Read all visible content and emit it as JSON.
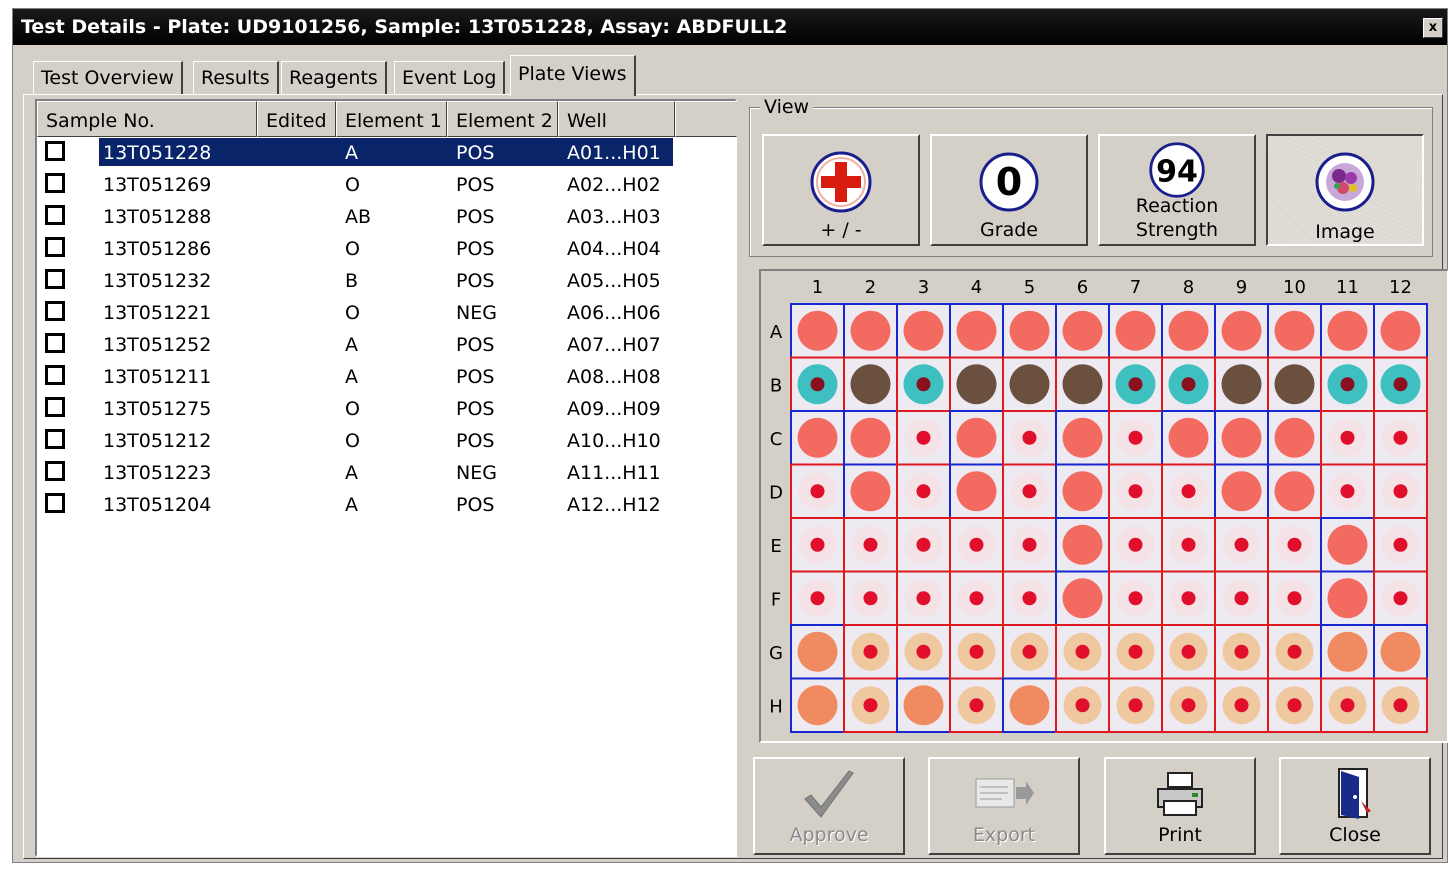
{
  "window": {
    "title": "Test Details - Plate: UD9101256, Sample: 13T051228, Assay: ABDFULL2",
    "close_label": "x"
  },
  "tabs": [
    {
      "label": "Test Overview",
      "active": false
    },
    {
      "label": "Results",
      "active": false
    },
    {
      "label": "Reagents",
      "active": false
    },
    {
      "label": "Event Log",
      "active": false
    },
    {
      "label": "Plate Views",
      "active": true
    }
  ],
  "list": {
    "columns": [
      "Sample No.",
      "Edited",
      "Element 1",
      "Element 2",
      "Well"
    ],
    "rows": [
      {
        "sample": "13T051228",
        "edited": "",
        "e1": "A",
        "e2": "POS",
        "well": "A01...H01",
        "checked": false,
        "selected": true
      },
      {
        "sample": "13T051269",
        "edited": "",
        "e1": "O",
        "e2": "POS",
        "well": "A02...H02",
        "checked": false,
        "selected": false
      },
      {
        "sample": "13T051288",
        "edited": "",
        "e1": "AB",
        "e2": "POS",
        "well": "A03...H03",
        "checked": false,
        "selected": false
      },
      {
        "sample": "13T051286",
        "edited": "",
        "e1": "O",
        "e2": "POS",
        "well": "A04...H04",
        "checked": false,
        "selected": false
      },
      {
        "sample": "13T051232",
        "edited": "",
        "e1": "B",
        "e2": "POS",
        "well": "A05...H05",
        "checked": false,
        "selected": false
      },
      {
        "sample": "13T051221",
        "edited": "",
        "e1": "O",
        "e2": "NEG",
        "well": "A06...H06",
        "checked": false,
        "selected": false
      },
      {
        "sample": "13T051252",
        "edited": "",
        "e1": "A",
        "e2": "POS",
        "well": "A07...H07",
        "checked": false,
        "selected": false
      },
      {
        "sample": "13T051211",
        "edited": "",
        "e1": "A",
        "e2": "POS",
        "well": "A08...H08",
        "checked": false,
        "selected": false
      },
      {
        "sample": "13T051275",
        "edited": "",
        "e1": "O",
        "e2": "POS",
        "well": "A09...H09",
        "checked": false,
        "selected": false
      },
      {
        "sample": "13T051212",
        "edited": "",
        "e1": "O",
        "e2": "POS",
        "well": "A10...H10",
        "checked": false,
        "selected": false
      },
      {
        "sample": "13T051223",
        "edited": "",
        "e1": "A",
        "e2": "NEG",
        "well": "A11...H11",
        "checked": false,
        "selected": false
      },
      {
        "sample": "13T051204",
        "edited": "",
        "e1": "A",
        "e2": "POS",
        "well": "A12...H12",
        "checked": false,
        "selected": false
      }
    ]
  },
  "view": {
    "group_label": "View",
    "buttons": [
      {
        "name": "plus-minus",
        "label": "+ / -",
        "icon": "plus-circle-icon",
        "pressed": false
      },
      {
        "name": "grade",
        "label": "Grade",
        "icon_text": "0",
        "icon": "grade-circle-icon",
        "pressed": false
      },
      {
        "name": "reaction-strength",
        "label_line1": "Reaction",
        "label_line2": "Strength",
        "icon_text": "94",
        "icon": "reaction-circle-icon",
        "pressed": false
      },
      {
        "name": "image",
        "label": "Image",
        "icon": "image-circle-icon",
        "pressed": true
      }
    ]
  },
  "plate": {
    "columns": [
      "1",
      "2",
      "3",
      "4",
      "5",
      "6",
      "7",
      "8",
      "9",
      "10",
      "11",
      "12"
    ],
    "rows": [
      "A",
      "B",
      "C",
      "D",
      "E",
      "F",
      "G",
      "H"
    ],
    "colors": {
      "positive_border": "#e0181f",
      "negative_border": "#1828d0"
    },
    "wells": [
      [
        "n",
        "n",
        "n",
        "n",
        "n",
        "n",
        "n",
        "n",
        "n",
        "n",
        "n",
        "n"
      ],
      [
        "p",
        "p",
        "p",
        "p",
        "p",
        "p",
        "p",
        "p",
        "p",
        "p",
        "p",
        "p"
      ],
      [
        "n",
        "n",
        "p",
        "n",
        "p",
        "n",
        "p",
        "n",
        "n",
        "n",
        "p",
        "p"
      ],
      [
        "p",
        "n",
        "p",
        "n",
        "p",
        "n",
        "p",
        "p",
        "n",
        "n",
        "p",
        "p"
      ],
      [
        "p",
        "p",
        "p",
        "p",
        "p",
        "n",
        "p",
        "p",
        "p",
        "p",
        "n",
        "p"
      ],
      [
        "p",
        "p",
        "p",
        "p",
        "p",
        "n",
        "p",
        "p",
        "p",
        "p",
        "n",
        "p"
      ],
      [
        "n",
        "p",
        "p",
        "p",
        "p",
        "p",
        "p",
        "p",
        "p",
        "p",
        "n",
        "n"
      ],
      [
        "n",
        "p",
        "n",
        "p",
        "n",
        "p",
        "p",
        "p",
        "p",
        "p",
        "p",
        "p"
      ]
    ]
  },
  "actions": [
    {
      "name": "approve",
      "label": "Approve",
      "icon": "checkmark-icon",
      "enabled": false
    },
    {
      "name": "export",
      "label": "Export",
      "icon": "export-icon",
      "enabled": false
    },
    {
      "name": "print",
      "label": "Print",
      "icon": "printer-icon",
      "enabled": true
    },
    {
      "name": "close",
      "label": "Close",
      "icon": "door-exit-icon",
      "enabled": true
    }
  ]
}
